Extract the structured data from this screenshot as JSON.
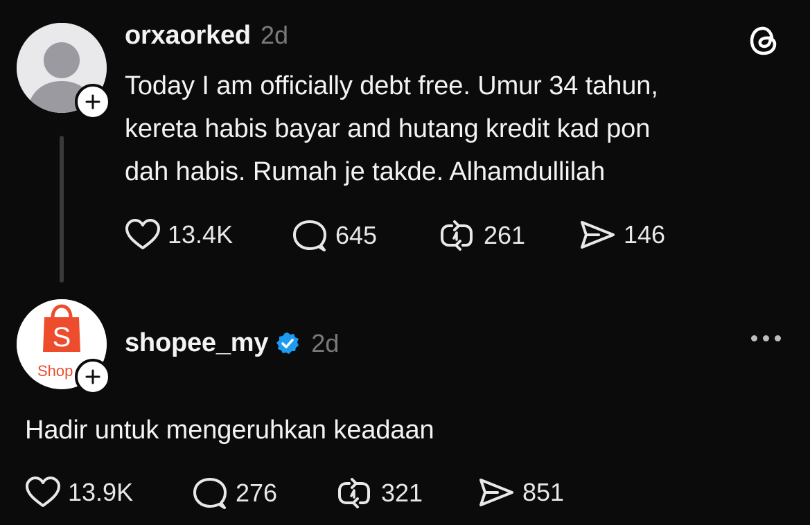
{
  "posts": [
    {
      "username": "orxaorked",
      "time": "2d",
      "text_lines": [
        "Today I am officially debt free. Umur 34 tahun,",
        "kereta habis bayar and hutang kredit kad pon",
        "dah habis. Rumah je takde. Alhamdullilah"
      ],
      "likes": "13.4K",
      "replies": "645",
      "reposts": "261",
      "shares": "146",
      "corner_icon": "threads-logo-icon"
    },
    {
      "username": "shopee_my",
      "verified": true,
      "time": "2d",
      "text": "Hadir untuk mengeruhkan keadaan",
      "likes": "13.9K",
      "replies": "276",
      "reposts": "321",
      "shares": "851",
      "avatar_logo_text": "Shop",
      "avatar_bag_letter": "S",
      "corner_icon": "more-options-icon"
    }
  ],
  "colors": {
    "background": "#0b0b0b",
    "text": "#f3f3f3",
    "muted": "#7a7a7a",
    "verified": "#1d9bf0",
    "shopee_orange": "#ee4d2d"
  }
}
